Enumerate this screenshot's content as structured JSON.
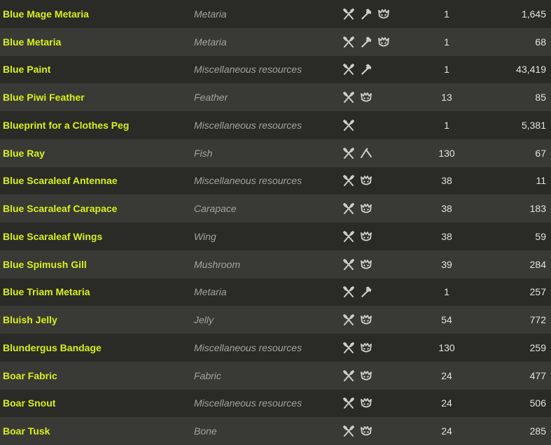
{
  "rows": [
    {
      "name": "Blue Mage Metaria",
      "type": "Metaria",
      "icons": [
        "utensils-icon",
        "hammer-icon",
        "monster-icon"
      ],
      "level": "1",
      "count": "1,645"
    },
    {
      "name": "Blue Metaria",
      "type": "Metaria",
      "icons": [
        "utensils-icon",
        "hammer-icon",
        "monster-icon"
      ],
      "level": "1",
      "count": "68"
    },
    {
      "name": "Blue Paint",
      "type": "Miscellaneous resources",
      "icons": [
        "utensils-icon",
        "hammer-icon"
      ],
      "level": "1",
      "count": "43,419"
    },
    {
      "name": "Blue Piwi Feather",
      "type": "Feather",
      "icons": [
        "utensils-icon",
        "monster-icon"
      ],
      "level": "13",
      "count": "85"
    },
    {
      "name": "Blueprint for a Clothes Peg",
      "type": "Miscellaneous resources",
      "icons": [
        "utensils-icon"
      ],
      "level": "1",
      "count": "5,381"
    },
    {
      "name": "Blue Ray",
      "type": "Fish",
      "icons": [
        "utensils-icon",
        "fishing-icon"
      ],
      "level": "130",
      "count": "67"
    },
    {
      "name": "Blue Scaraleaf Antennae",
      "type": "Miscellaneous resources",
      "icons": [
        "utensils-icon",
        "monster-icon"
      ],
      "level": "38",
      "count": "11"
    },
    {
      "name": "Blue Scaraleaf Carapace",
      "type": "Carapace",
      "icons": [
        "utensils-icon",
        "monster-icon"
      ],
      "level": "38",
      "count": "183"
    },
    {
      "name": "Blue Scaraleaf Wings",
      "type": "Wing",
      "icons": [
        "utensils-icon",
        "monster-icon"
      ],
      "level": "38",
      "count": "59"
    },
    {
      "name": "Blue Spimush Gill",
      "type": "Mushroom",
      "icons": [
        "utensils-icon",
        "monster-icon"
      ],
      "level": "39",
      "count": "284"
    },
    {
      "name": "Blue Triam Metaria",
      "type": "Metaria",
      "icons": [
        "utensils-icon",
        "hammer-icon"
      ],
      "level": "1",
      "count": "257"
    },
    {
      "name": "Bluish Jelly",
      "type": "Jelly",
      "icons": [
        "utensils-icon",
        "monster-icon"
      ],
      "level": "54",
      "count": "772"
    },
    {
      "name": "Blundergus Bandage",
      "type": "Miscellaneous resources",
      "icons": [
        "utensils-icon",
        "monster-icon"
      ],
      "level": "130",
      "count": "259"
    },
    {
      "name": "Boar Fabric",
      "type": "Fabric",
      "icons": [
        "utensils-icon",
        "monster-icon"
      ],
      "level": "24",
      "count": "477"
    },
    {
      "name": "Boar Snout",
      "type": "Miscellaneous resources",
      "icons": [
        "utensils-icon",
        "monster-icon"
      ],
      "level": "24",
      "count": "506"
    },
    {
      "name": "Boar Tusk",
      "type": "Bone",
      "icons": [
        "utensils-icon",
        "monster-icon"
      ],
      "level": "24",
      "count": "285"
    }
  ],
  "colors": {
    "name": "#d8f01a",
    "type": "#a3a39c",
    "number": "#e3e3dc",
    "icon": "#cfcfca",
    "row_dark": "#2a2b27",
    "row_light": "#393a35"
  }
}
